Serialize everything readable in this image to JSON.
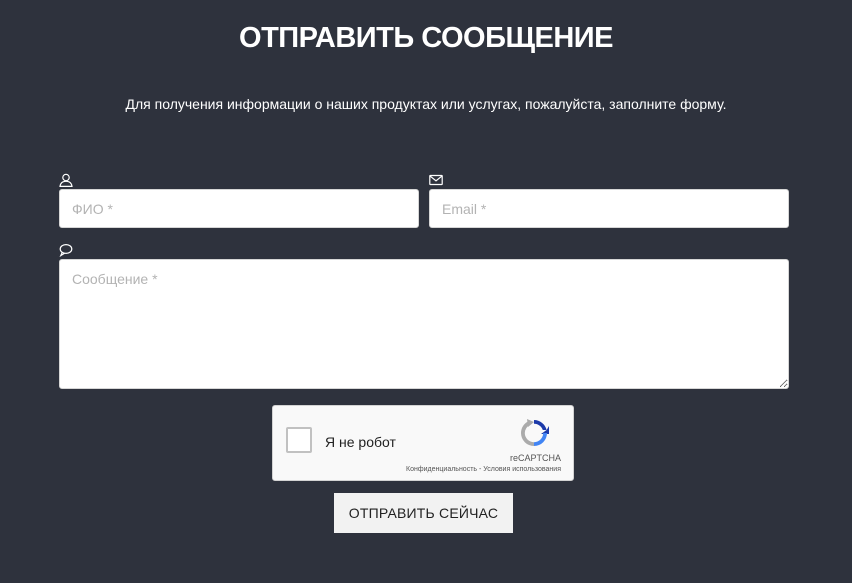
{
  "header": {
    "title": "ОТПРАВИТЬ СООБЩЕНИЕ",
    "subtitle": "Для получения информации о наших продуктах или услугах, пожалуйста, заполните форму."
  },
  "form": {
    "name": {
      "icon": "user-icon",
      "value": "",
      "placeholder": "ФИО *"
    },
    "email": {
      "icon": "envelope-icon",
      "value": "",
      "placeholder": "Email *"
    },
    "message": {
      "icon": "speech-bubble-icon",
      "value": "",
      "placeholder": "Сообщение *"
    },
    "submit_label": "ОТПРАВИТЬ СЕЙЧАС"
  },
  "recaptcha": {
    "label": "Я не робот",
    "brand": "reCAPTCHA",
    "privacy": "Конфиденциальность",
    "separator": " - ",
    "terms": "Условия использования",
    "checked": false
  },
  "colors": {
    "background": "#2e323d",
    "text": "#ffffff",
    "input_background": "#ffffff",
    "placeholder": "#b3b3b3",
    "button_background": "#f2f2f2"
  }
}
